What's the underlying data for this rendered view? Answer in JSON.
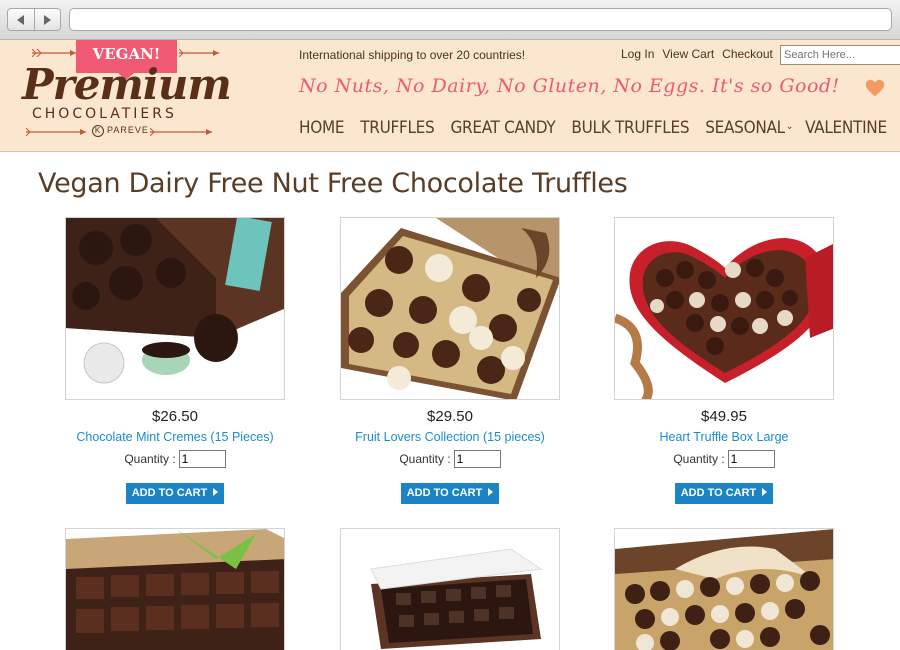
{
  "header": {
    "logo_banner": "VEGAN!",
    "logo_main": "Premium",
    "logo_sub": "CHOCOLATIERS",
    "logo_pareve": "PAREVE",
    "shipping": "International shipping to over 20 countries!",
    "links": [
      "Log In",
      "View Cart",
      "Checkout"
    ],
    "search_placeholder": "Search Here...",
    "tagline": "No Nuts, No Dairy, No Gluten, No Eggs. It's so Good!",
    "nav": [
      "HOME",
      "TRUFFLES",
      "GREAT CANDY",
      "BULK TRUFFLES",
      "SEASONAL",
      "VALENTINE"
    ]
  },
  "page_title": "Vegan Dairy Free Nut Free Chocolate Truffles",
  "products": [
    {
      "price": "$26.50",
      "name": "Chocolate Mint Cremes (15 Pieces)",
      "qty_label": "Quantity :",
      "qty": "1",
      "button": "ADD TO CART"
    },
    {
      "price": "$29.50",
      "name": "Fruit Lovers Collection (15 pieces)",
      "qty_label": "Quantity :",
      "qty": "1",
      "button": "ADD TO CART"
    },
    {
      "price": "$49.95",
      "name": "Heart Truffle Box Large",
      "qty_label": "Quantity :",
      "qty": "1",
      "button": "ADD TO CART"
    }
  ],
  "colors": {
    "header_bg": "#fbe7cf",
    "brand_brown": "#5a2f17",
    "tagline_pink": "#ee5a6d",
    "link_blue": "#1a8dcf",
    "button_blue": "#1b84c5"
  }
}
